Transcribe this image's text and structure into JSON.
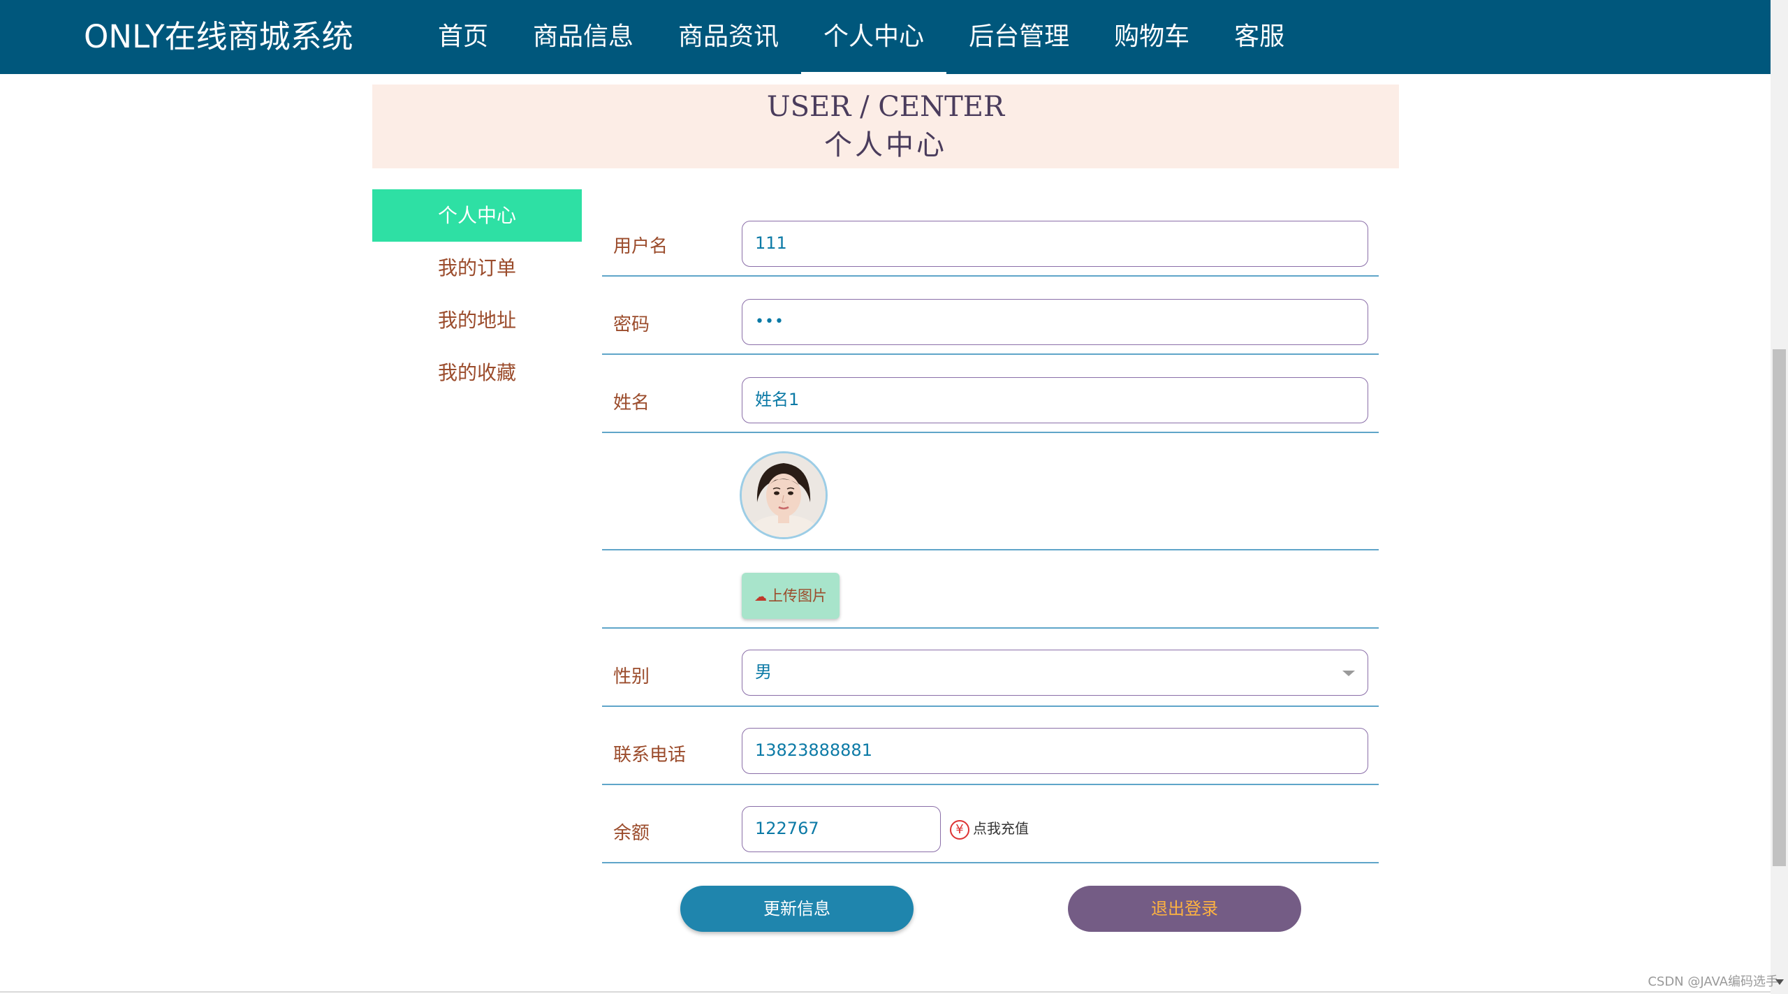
{
  "header": {
    "brand": "ONLY在线商城系统",
    "nav": [
      "首页",
      "商品信息",
      "商品资讯",
      "个人中心",
      "后台管理",
      "购物车",
      "客服"
    ],
    "active_nav": "个人中心"
  },
  "banner": {
    "en": "USER / CENTER",
    "cn": "个人中心"
  },
  "sidebar": {
    "items": [
      {
        "label": "个人中心",
        "active": true
      },
      {
        "label": "我的订单",
        "active": false
      },
      {
        "label": "我的地址",
        "active": false
      },
      {
        "label": "我的收藏",
        "active": false
      }
    ]
  },
  "form": {
    "username": {
      "label": "用户名",
      "value": "111"
    },
    "password": {
      "label": "密码",
      "value": "•••"
    },
    "name": {
      "label": "姓名",
      "value": "姓名1"
    },
    "avatar_icon": "avatar-photo",
    "upload_label": "上传图片",
    "gender": {
      "label": "性别",
      "value": "男"
    },
    "phone": {
      "label": "联系电话",
      "value": "13823888881"
    },
    "balance": {
      "label": "余额",
      "value": "122767",
      "recharge_label": "点我充值",
      "currency_symbol": "¥"
    }
  },
  "actions": {
    "update_label": "更新信息",
    "logout_label": "退出登录"
  },
  "watermark": "CSDN @JAVA编码选手",
  "colors": {
    "topbar": "#00577c",
    "banner_bg": "#fcede6",
    "side_active": "#2ee0a4",
    "label": "#9b4c2c",
    "input_text": "#0c7aa6",
    "update_btn": "#1f85ad",
    "logout_btn": "#745c85",
    "logout_text": "#ffb340"
  }
}
